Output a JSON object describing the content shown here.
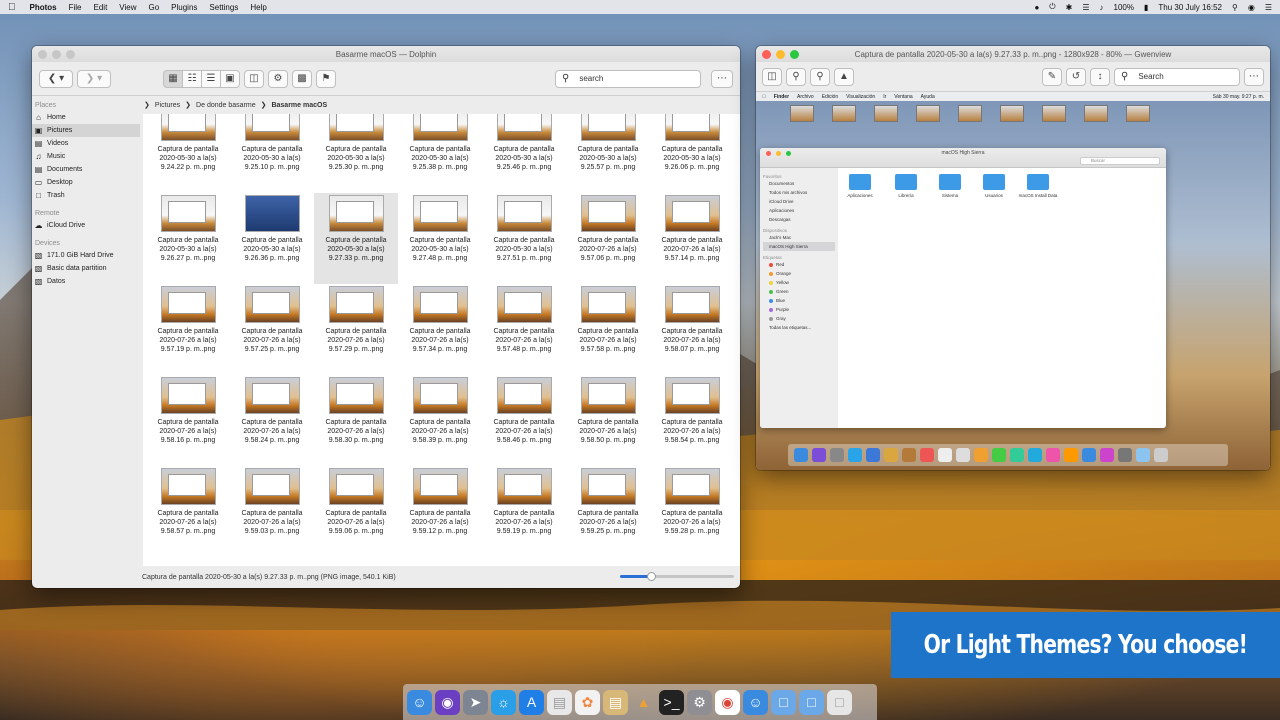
{
  "menubar": {
    "app": "Photos",
    "items": [
      "File",
      "Edit",
      "View",
      "Go",
      "Plugins",
      "Settings",
      "Help"
    ],
    "battery": "100%",
    "clock": "Thu 30 July 16:52"
  },
  "dolphin": {
    "title": "Basarme macOS — Dolphin",
    "search_placeholder": "search",
    "places_header": "Places",
    "places": [
      "Home",
      "Pictures",
      "Videos",
      "Music",
      "Documents",
      "Desktop",
      "Trash"
    ],
    "remote_header": "Remote",
    "remote": [
      "iCloud Drive"
    ],
    "devices_header": "Devices",
    "devices": [
      "171.0 GiB Hard Drive",
      "Basic data partition",
      "Datos"
    ],
    "breadcrumbs": [
      "Pictures",
      "De donde basarme",
      "Basarme macOS"
    ],
    "files": [
      {
        "l1": "Captura de pantalla",
        "l2": "2020-05-30 a la(s)",
        "l3": "9.24.22 p. m..png"
      },
      {
        "l1": "Captura de pantalla",
        "l2": "2020-05-30 a la(s)",
        "l3": "9.25.10 p. m..png"
      },
      {
        "l1": "Captura de pantalla",
        "l2": "2020-05-30 a la(s)",
        "l3": "9.25.30 p. m..png"
      },
      {
        "l1": "Captura de pantalla",
        "l2": "2020-05-30 a la(s)",
        "l3": "9.25.38 p. m..png"
      },
      {
        "l1": "Captura de pantalla",
        "l2": "2020-05-30 a la(s)",
        "l3": "9.25.46 p. m..png"
      },
      {
        "l1": "Captura de pantalla",
        "l2": "2020-05-30 a la(s)",
        "l3": "9.25.57 p. m..png"
      },
      {
        "l1": "Captura de pantalla",
        "l2": "2020-05-30 a la(s)",
        "l3": "9.26.06 p. m..png"
      },
      {
        "l1": "Captura de pantalla",
        "l2": "2020-05-30 a la(s)",
        "l3": "9.26.27 p. m..png"
      },
      {
        "l1": "Captura de pantalla",
        "l2": "2020-05-30 a la(s)",
        "l3": "9.26.36 p. m..png"
      },
      {
        "l1": "Captura de pantalla",
        "l2": "2020-05-30 a la(s)",
        "l3": "9.27.33 p. m..png"
      },
      {
        "l1": "Captura de pantalla",
        "l2": "2020-05-30 a la(s)",
        "l3": "9.27.48 p. m..png"
      },
      {
        "l1": "Captura de pantalla",
        "l2": "2020-05-30 a la(s)",
        "l3": "9.27.51 p. m..png"
      },
      {
        "l1": "Captura de pantalla",
        "l2": "2020-07-26 a la(s)",
        "l3": "9.57.06 p. m..png"
      },
      {
        "l1": "Captura de pantalla",
        "l2": "2020-07-26 a la(s)",
        "l3": "9.57.14 p. m..png"
      },
      {
        "l1": "Captura de pantalla",
        "l2": "2020-07-26 a la(s)",
        "l3": "9.57.19 p. m..png"
      },
      {
        "l1": "Captura de pantalla",
        "l2": "2020-07-26 a la(s)",
        "l3": "9.57.25 p. m..png"
      },
      {
        "l1": "Captura de pantalla",
        "l2": "2020-07-26 a la(s)",
        "l3": "9.57.29 p. m..png"
      },
      {
        "l1": "Captura de pantalla",
        "l2": "2020-07-26 a la(s)",
        "l3": "9.57.34 p. m..png"
      },
      {
        "l1": "Captura de pantalla",
        "l2": "2020-07-26 a la(s)",
        "l3": "9.57.48 p. m..png"
      },
      {
        "l1": "Captura de pantalla",
        "l2": "2020-07-26 a la(s)",
        "l3": "9.57.58 p. m..png"
      },
      {
        "l1": "Captura de pantalla",
        "l2": "2020-07-26 a la(s)",
        "l3": "9.58.07 p. m..png"
      },
      {
        "l1": "Captura de pantalla",
        "l2": "2020-07-26 a la(s)",
        "l3": "9.58.16 p. m..png"
      },
      {
        "l1": "Captura de pantalla",
        "l2": "2020-07-26 a la(s)",
        "l3": "9.58.24 p. m..png"
      },
      {
        "l1": "Captura de pantalla",
        "l2": "2020-07-26 a la(s)",
        "l3": "9.58.30 p. m..png"
      },
      {
        "l1": "Captura de pantalla",
        "l2": "2020-07-26 a la(s)",
        "l3": "9.58.39 p. m..png"
      },
      {
        "l1": "Captura de pantalla",
        "l2": "2020-07-26 a la(s)",
        "l3": "9.58.46 p. m..png"
      },
      {
        "l1": "Captura de pantalla",
        "l2": "2020-07-26 a la(s)",
        "l3": "9.58.50 p. m..png"
      },
      {
        "l1": "Captura de pantalla",
        "l2": "2020-07-26 a la(s)",
        "l3": "9.58.54 p. m..png"
      },
      {
        "l1": "Captura de pantalla",
        "l2": "2020-07-26 a la(s)",
        "l3": "9.58.57 p. m..png"
      },
      {
        "l1": "Captura de pantalla",
        "l2": "2020-07-26 a la(s)",
        "l3": "9.59.03 p. m..png"
      },
      {
        "l1": "Captura de pantalla",
        "l2": "2020-07-26 a la(s)",
        "l3": "9.59.06 p. m..png"
      },
      {
        "l1": "Captura de pantalla",
        "l2": "2020-07-26 a la(s)",
        "l3": "9.59.12 p. m..png"
      },
      {
        "l1": "Captura de pantalla",
        "l2": "2020-07-26 a la(s)",
        "l3": "9.59.19 p. m..png"
      },
      {
        "l1": "Captura de pantalla",
        "l2": "2020-07-26 a la(s)",
        "l3": "9.59.25 p. m..png"
      },
      {
        "l1": "Captura de pantalla",
        "l2": "2020-07-26 a la(s)",
        "l3": "9.59.28 p. m..png"
      }
    ],
    "status": "Captura de pantalla 2020-05-30 a la(s) 9.27.33 p. m..png (PNG image, 540.1 KiB)",
    "zoom_fraction": 0.28
  },
  "gwenview": {
    "title": "Captura de pantalla 2020-05-30 a la(s) 9.27.33 p. m..png - 1280x928 - 80% — Gwenview",
    "search_placeholder": "Search",
    "image": {
      "menubar": [
        "Finder",
        "Archivo",
        "Edición",
        "Visualización",
        "Ir",
        "Ventana",
        "Ayuda"
      ],
      "clock": "Sáb 30 may.  9:27 p. m.",
      "finder_title": "macOS High Sierra",
      "finder_search": "Buscar",
      "favorites_header": "Favoritos",
      "favorites": [
        "Documentos",
        "Todos mis archivos",
        "iCloud Drive",
        "Aplicaciones",
        "Descargas"
      ],
      "devices_header": "Dispositivos",
      "devices": [
        "Jack's Mac",
        "macOS High Sierra"
      ],
      "tags_header": "Etiquetas",
      "tags": [
        {
          "name": "Red",
          "color": "#ee4b3b"
        },
        {
          "name": "Orange",
          "color": "#f39a2b"
        },
        {
          "name": "Yellow",
          "color": "#f4cf3a"
        },
        {
          "name": "Green",
          "color": "#4cc14a"
        },
        {
          "name": "Blue",
          "color": "#3d8ce8"
        },
        {
          "name": "Purple",
          "color": "#a56bd8"
        },
        {
          "name": "Gray",
          "color": "#999999"
        }
      ],
      "all_tags": "Todas las etiquetas...",
      "folders": [
        "Aplicaciones",
        "Librería",
        "Sistema",
        "Usuarios",
        "macOS Install Data"
      ]
    }
  },
  "banner": {
    "text": "Or Light Themes? You choose!",
    "color": "#1d74c9"
  }
}
